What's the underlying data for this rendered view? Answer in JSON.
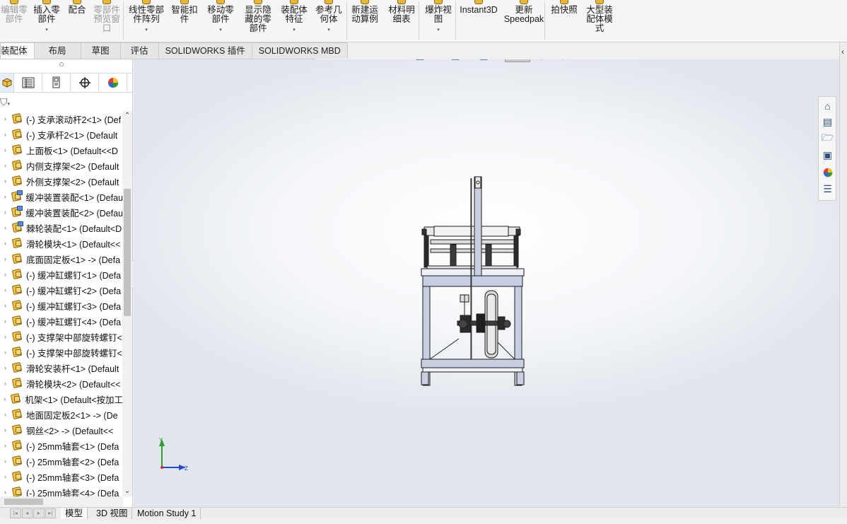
{
  "ribbon": {
    "buttons": [
      {
        "label": "编辑零\n部件",
        "dropdown": false,
        "disabled": true
      },
      {
        "label": "插入零\n部件",
        "dropdown": true,
        "disabled": false
      },
      {
        "label": "配合",
        "dropdown": false,
        "disabled": false
      },
      {
        "label": "零部件\n预览窗\n口",
        "dropdown": false,
        "disabled": true
      },
      {
        "label": "线性零部\n件阵列",
        "dropdown": true,
        "disabled": false
      },
      {
        "label": "智能扣\n件",
        "dropdown": false,
        "disabled": false
      },
      {
        "label": "移动零\n部件",
        "dropdown": true,
        "disabled": false
      },
      {
        "label": "显示隐\n藏的零\n部件",
        "dropdown": false,
        "disabled": false
      },
      {
        "label": "装配体\n特征",
        "dropdown": true,
        "disabled": false
      },
      {
        "label": "参考几\n何体",
        "dropdown": true,
        "disabled": false
      },
      {
        "label": "新建运\n动算例",
        "dropdown": false,
        "disabled": false
      },
      {
        "label": "材料明\n细表",
        "dropdown": false,
        "disabled": false
      },
      {
        "label": "爆炸视\n图",
        "dropdown": true,
        "disabled": false
      },
      {
        "label": "Instant3D",
        "dropdown": false,
        "disabled": false
      },
      {
        "label": "更新\nSpeedpak",
        "dropdown": false,
        "disabled": false
      },
      {
        "label": "拍快照",
        "dropdown": false,
        "disabled": false
      },
      {
        "label": "大型装\n配体模\n式",
        "dropdown": false,
        "disabled": false
      }
    ]
  },
  "command_tabs": [
    "装配体",
    "布局",
    "草图",
    "评估",
    "SOLIDWORKS 插件",
    "SOLIDWORKS MBD"
  ],
  "feature_tree": {
    "items": [
      {
        "label": "(-) 支承滚动杆2<1> (Def",
        "type": "part"
      },
      {
        "label": "(-) 支承杆2<1> (Default",
        "type": "part"
      },
      {
        "label": "上面板<1> (Default<<D",
        "type": "part"
      },
      {
        "label": "内侧支撑架<2> (Default",
        "type": "part"
      },
      {
        "label": "外侧支撑架<2> (Default",
        "type": "part"
      },
      {
        "label": "缓冲装置装配<1> (Defau",
        "type": "assembly"
      },
      {
        "label": "缓冲装置装配<2> (Defau",
        "type": "assembly"
      },
      {
        "label": "棘轮装配<1> (Default<D",
        "type": "assembly"
      },
      {
        "label": "滑轮模块<1> (Default<<",
        "type": "part"
      },
      {
        "label": "底面固定板<1> -> (Defa",
        "type": "part"
      },
      {
        "label": "(-) 缓冲缸螺钉<1> (Defa",
        "type": "part"
      },
      {
        "label": "(-) 缓冲缸螺钉<2> (Defa",
        "type": "part"
      },
      {
        "label": "(-) 缓冲缸螺钉<3> (Defa",
        "type": "part"
      },
      {
        "label": "(-) 缓冲缸螺钉<4> (Defa",
        "type": "part"
      },
      {
        "label": "(-) 支撑架中部旋转螺钉<",
        "type": "part"
      },
      {
        "label": "(-) 支撑架中部旋转螺钉<",
        "type": "part"
      },
      {
        "label": "滑轮安装杆<1> (Default",
        "type": "part"
      },
      {
        "label": "滑轮模块<2> (Default<<",
        "type": "part"
      },
      {
        "label": "机架<1> (Default<按加工",
        "type": "part"
      },
      {
        "label": "地面固定板2<1> -> (De",
        "type": "part"
      },
      {
        "label": "钢丝<2> -> (Default<<",
        "type": "part"
      },
      {
        "label": "(-) 25mm轴套<1> (Defa",
        "type": "part"
      },
      {
        "label": "(-) 25mm轴套<2> (Defa",
        "type": "part"
      },
      {
        "label": "(-) 25mm轴套<3> (Defa",
        "type": "part"
      },
      {
        "label": "(-) 25mm轴套<4> (Defa",
        "type": "part"
      }
    ]
  },
  "bottom_tabs": [
    "模型",
    "3D 视图",
    "Motion Study 1"
  ],
  "triad": {
    "y": "Y",
    "z": "Z"
  },
  "colors": {
    "accent_blue": "#3a5f8f",
    "part_yellow": "#f0c24a",
    "triad_green": "#2e9e2e",
    "triad_blue": "#2a48c8"
  }
}
